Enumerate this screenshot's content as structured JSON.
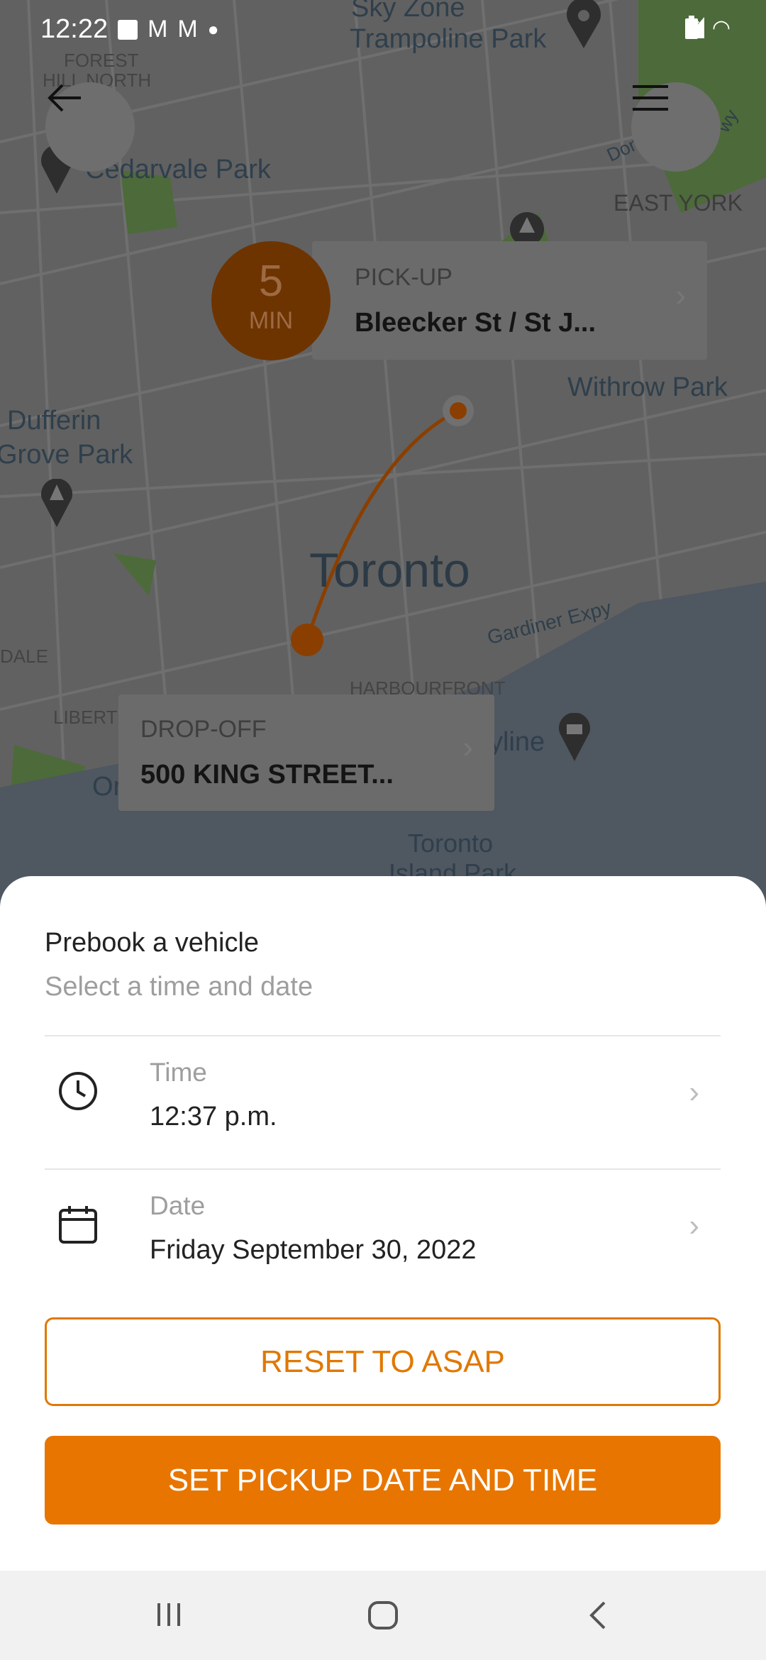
{
  "status_bar": {
    "time": "12:22",
    "icons": [
      "gallery-icon",
      "gmail-icon",
      "gmail-icon",
      "dot-icon",
      "mute-icon",
      "wifi-icon",
      "signal-icon",
      "battery-icon"
    ]
  },
  "map": {
    "labels": {
      "sky_zone": "Sky Zone",
      "trampoline": "Trampoline Park",
      "forest": "FOREST",
      "hill_north": "HILL NORTH",
      "cedarvale": "Cedarvale Park",
      "east_york": "EAST YORK",
      "withrow": "Withrow Park",
      "dufferin": "Dufferin",
      "grove": "Grove Park",
      "toronto": "Toronto",
      "gardiner": "Gardiner Expy",
      "harbourfront": "HARBOURFRONT",
      "liberty": "LIBERT",
      "dale": "DALE",
      "skyline": "yline",
      "island": "Toronto",
      "island2": "Island Park",
      "don": "Don",
      "wy": "wy",
      "or": "Or"
    },
    "eta": {
      "value": "5",
      "unit": "MIN"
    },
    "pickup": {
      "label": "PICK-UP",
      "value": "Bleecker St / St J..."
    },
    "dropoff": {
      "label": "DROP-OFF",
      "value": "500 KING STREET..."
    },
    "colors": {
      "route": "#8a3f00",
      "eta_bg": "#6d3400"
    }
  },
  "sheet": {
    "title": "Prebook a vehicle",
    "subtitle": "Select a time and date",
    "time": {
      "label": "Time",
      "value": "12:37 p.m."
    },
    "date": {
      "label": "Date",
      "value": "Friday September 30, 2022"
    },
    "reset_label": "RESET TO ASAP",
    "set_label": "SET PICKUP DATE AND TIME",
    "accent": "#e87500"
  }
}
